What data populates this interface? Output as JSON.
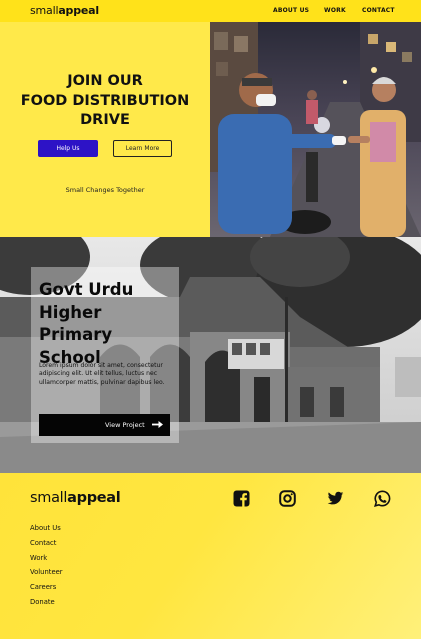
{
  "header": {
    "logo_light": "small",
    "logo_bold": "appeal",
    "nav": [
      "ABOUT US",
      "WORK",
      "CONTACT"
    ]
  },
  "hero": {
    "title_lines": [
      "JOIN OUR",
      "FOOD DISTRIBUTION",
      "DRIVE"
    ],
    "primary_button": "Help Us",
    "secondary_button": "Learn More",
    "tagline": "Small Changes Together"
  },
  "project": {
    "title_lines": [
      "Govt Urdu",
      "Higher Primary",
      "School"
    ],
    "description": "Lorem ipsum dolor sit amet, consectetur adipiscing elit. Ut elit tellus, luctus nec ullamcorper mattis, pulvinar dapibus leo.",
    "button": "View Project"
  },
  "footer": {
    "logo_light": "small",
    "logo_bold": "appeal",
    "links": [
      "About Us",
      "Contact",
      "Work",
      "Volunteer",
      "Careers",
      "Donate"
    ]
  },
  "colors": {
    "accent_yellow": "#ffe21a",
    "button_blue": "#2d13c6"
  }
}
